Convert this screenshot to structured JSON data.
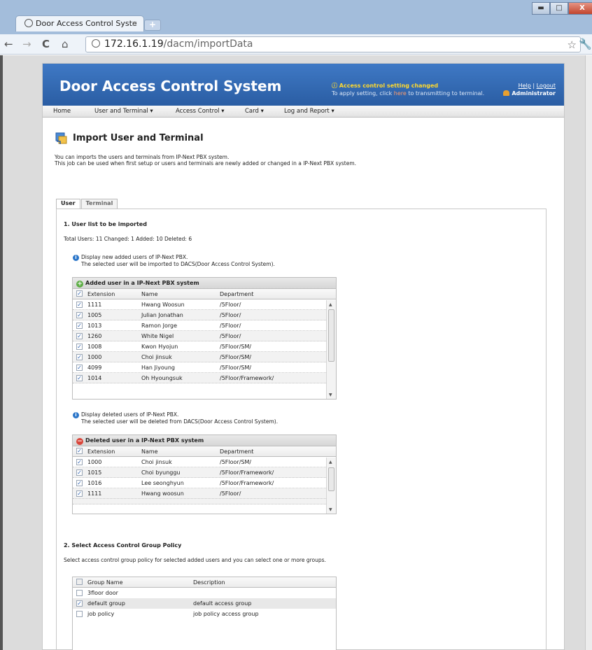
{
  "browser": {
    "tab_title": "Door Access Control Syste",
    "tab_close": "×",
    "new_tab": "+",
    "window_buttons": {
      "minimize": "▬",
      "maximize": "□",
      "close": "X"
    },
    "nav": {
      "back": "←",
      "forward": "→",
      "reload": "C",
      "home": "⌂"
    },
    "url_host": "172.16.1.19",
    "url_path": "/dacm/importData"
  },
  "app": {
    "title": "Door Access Control System",
    "notice_line1": "Access control setting changed",
    "notice_line2a": "To apply setting, click ",
    "notice_here": "here",
    "notice_line2b": " to transmitting to terminal.",
    "help": "Help",
    "separator": " | ",
    "logout": "Logout",
    "user": "Administrator"
  },
  "menu": [
    "Home",
    "User and Terminal ▾",
    "Access Control ▾",
    "Card ▾",
    "Log and Report ▾"
  ],
  "page": {
    "title": "Import User and Terminal",
    "desc1": "You can imports the users and terminals from IP-Next PBX system.",
    "desc2": "This job can be used when first setup or users and terminals are newly added or changed in a IP-Next PBX system."
  },
  "tabs": [
    "User",
    "Terminal"
  ],
  "section1": {
    "heading": "1. User list to be imported",
    "summary": "Total Users: 11  Changed: 1  Added: 10  Deleted: 6",
    "added_info1": "Display new added users of IP-Next PBX.",
    "added_info2": "The selected user will be imported to DACS(Door Access Control System).",
    "deleted_info1": "Display deleted users of IP-Next PBX.",
    "deleted_info2": "The selected user will be deleted from DACS(Door Access Control System)."
  },
  "columns": {
    "extension": "Extension",
    "name": "Name",
    "department": "Department"
  },
  "added_grid": {
    "title": "Added user in a IP-Next PBX system",
    "rows": [
      {
        "ext": "1111",
        "name": "Hwang Woosun",
        "dept": "/5Floor/"
      },
      {
        "ext": "1005",
        "name": "Julian Jonathan",
        "dept": "/5Floor/"
      },
      {
        "ext": "1013",
        "name": "Ramon Jorge",
        "dept": "/5Floor/"
      },
      {
        "ext": "1260",
        "name": "White Nigel",
        "dept": "/5Floor/"
      },
      {
        "ext": "1008",
        "name": "Kwon Hyojun",
        "dept": "/5Floor/SM/"
      },
      {
        "ext": "1000",
        "name": "Choi jinsuk",
        "dept": "/5Floor/SM/"
      },
      {
        "ext": "4099",
        "name": "Han Jiyoung",
        "dept": "/5Floor/SM/"
      },
      {
        "ext": "1014",
        "name": "Oh Hyoungsuk",
        "dept": "/5Floor/Framework/"
      }
    ]
  },
  "deleted_grid": {
    "title": "Deleted user in a IP-Next PBX system",
    "rows": [
      {
        "ext": "1000",
        "name": "Choi jinsuk",
        "dept": "/5Floor/SM/"
      },
      {
        "ext": "1015",
        "name": "Choi byunggu",
        "dept": "/5Floor/Framework/"
      },
      {
        "ext": "1016",
        "name": "Lee seonghyun",
        "dept": "/5Floor/Framework/"
      },
      {
        "ext": "1111",
        "name": "Hwang woosun",
        "dept": "/5Floor/"
      }
    ]
  },
  "section2": {
    "heading": "2. Select Access Control Group Policy",
    "desc": "Select access control group policy for selected added users and you can select one or more groups."
  },
  "group_grid": {
    "col_name": "Group Name",
    "col_desc": "Description",
    "rows": [
      {
        "name": "3floor door",
        "desc": "",
        "checked": false
      },
      {
        "name": "default group",
        "desc": "default access group",
        "checked": true
      },
      {
        "name": "job policy",
        "desc": "job policy access group",
        "checked": false
      }
    ]
  },
  "colors": {
    "banner": "#2f66ad",
    "notice": "#ffd92e",
    "check": "#2a5fb0"
  }
}
